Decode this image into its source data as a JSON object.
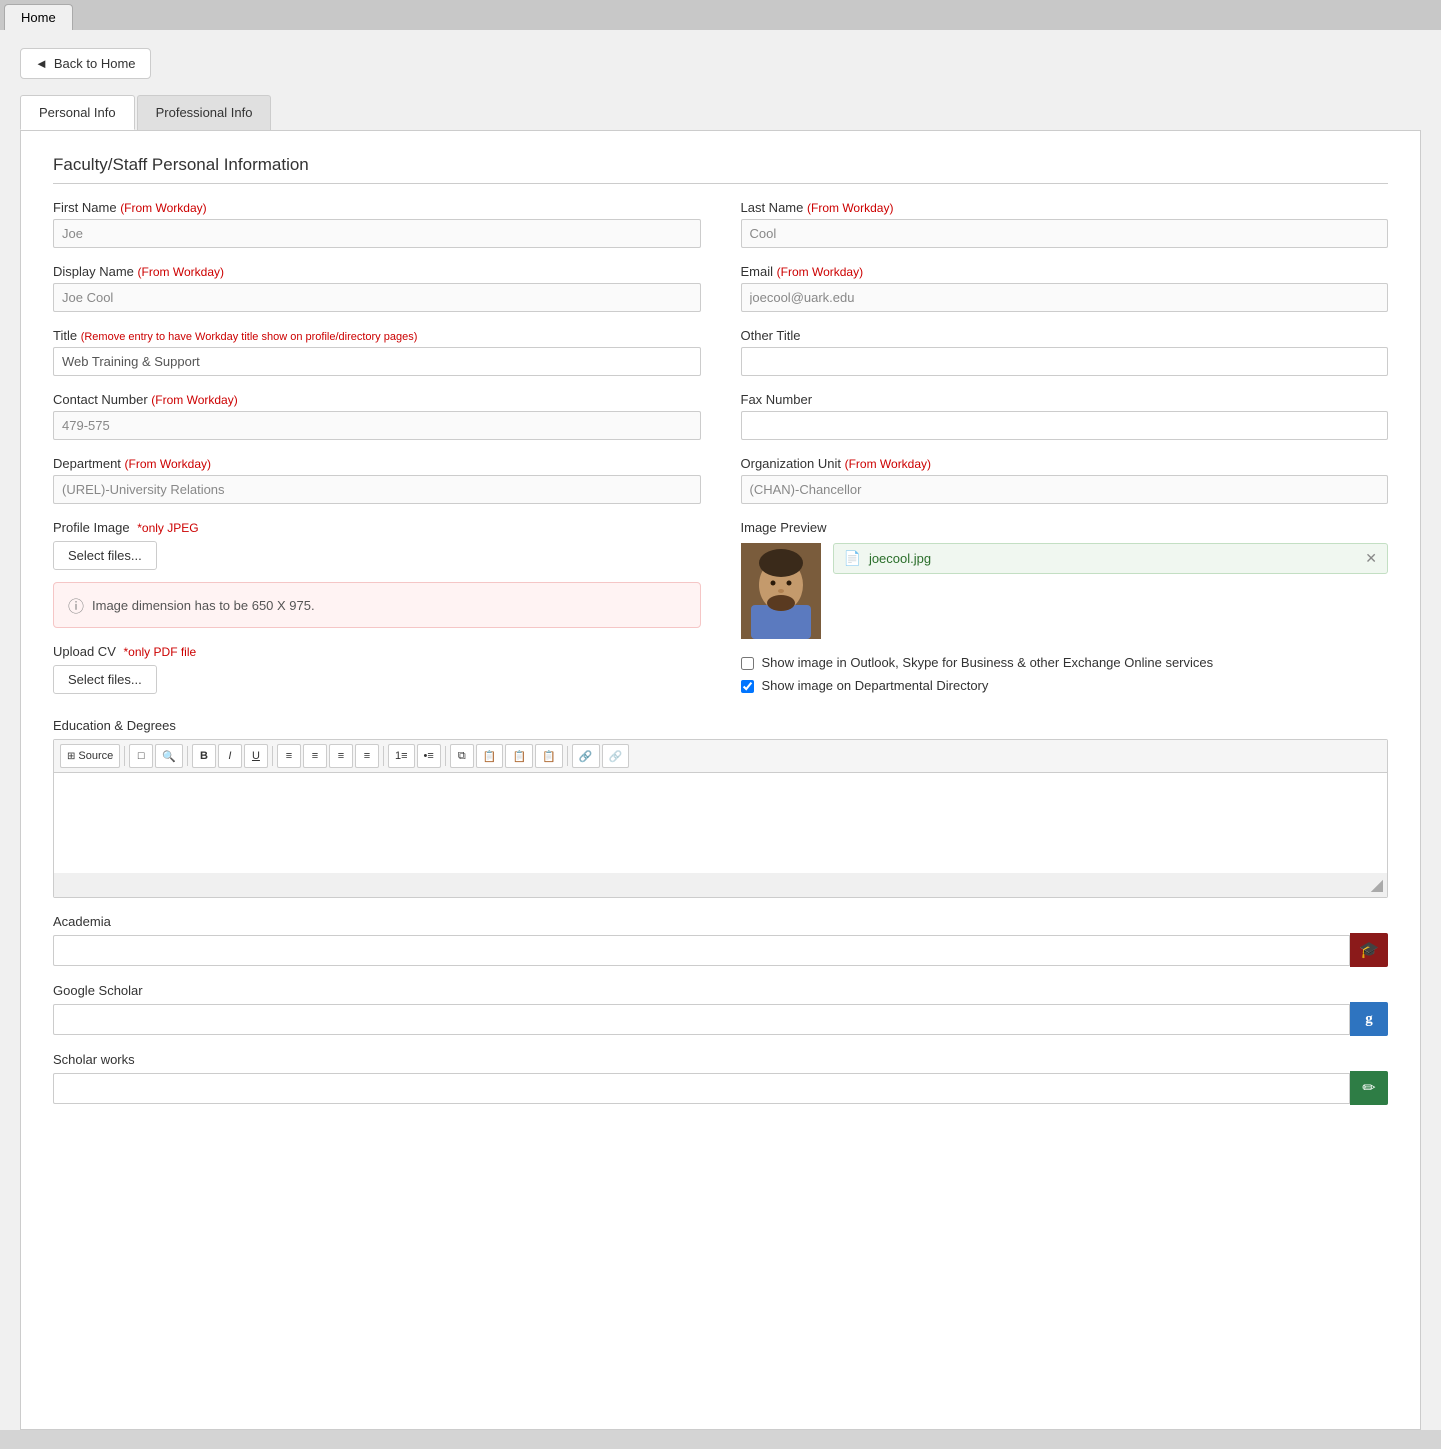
{
  "browser": {
    "tab_label": "Home"
  },
  "header": {
    "back_button_label": "Back to Home",
    "back_icon": "◄"
  },
  "tabs": [
    {
      "id": "personal",
      "label": "Personal Info",
      "active": true
    },
    {
      "id": "professional",
      "label": "Professional Info",
      "active": false
    }
  ],
  "form": {
    "section_title": "Faculty/Staff Personal Information",
    "first_name_label": "First Name",
    "first_name_from": "(From Workday)",
    "first_name_value": "Joe",
    "last_name_label": "Last Name",
    "last_name_from": "(From Workday)",
    "last_name_value": "Cool",
    "display_name_label": "Display Name",
    "display_name_from": "(From Workday)",
    "display_name_value": "Joe Cool",
    "email_label": "Email",
    "email_from": "(From Workday)",
    "email_value": "joecool@uark.edu",
    "title_label": "Title",
    "title_note": "(Remove entry to have Workday title show on profile/directory pages)",
    "title_value": "Web Training & Support",
    "other_title_label": "Other Title",
    "other_title_value": "",
    "contact_number_label": "Contact Number",
    "contact_number_from": "(From Workday)",
    "contact_number_value": "479-575",
    "fax_number_label": "Fax Number",
    "fax_number_value": "",
    "department_label": "Department",
    "department_from": "(From Workday)",
    "department_value": "(UREL)-University Relations",
    "org_unit_label": "Organization Unit",
    "org_unit_from": "(From Workday)",
    "org_unit_value": "(CHAN)-Chancellor",
    "profile_image_label": "Profile Image",
    "profile_image_note": "*only JPEG",
    "select_files_label": "Select files...",
    "image_warning": "Image dimension has to be 650 X 975.",
    "image_preview_label": "Image Preview",
    "file_name": "joecool.jpg",
    "upload_cv_label": "Upload CV",
    "upload_cv_note": "*only PDF file",
    "select_files_cv_label": "Select files...",
    "show_image_outlook_label": "Show image in Outlook, Skype for Business & other Exchange Online services",
    "show_image_outlook_checked": false,
    "show_image_directory_label": "Show image on Departmental Directory",
    "show_image_directory_checked": true,
    "education_label": "Education & Degrees",
    "rte_buttons": [
      {
        "id": "source",
        "label": "Source",
        "icon": "☰"
      },
      {
        "id": "new-page",
        "label": "",
        "icon": "📄"
      },
      {
        "id": "preview",
        "label": "",
        "icon": "🔍"
      },
      {
        "id": "bold",
        "label": "B",
        "icon": "B"
      },
      {
        "id": "italic",
        "label": "I",
        "icon": "I"
      },
      {
        "id": "underline",
        "label": "U",
        "icon": "U"
      },
      {
        "id": "align-left",
        "label": "",
        "icon": "≡"
      },
      {
        "id": "align-center",
        "label": "",
        "icon": "≡"
      },
      {
        "id": "align-right",
        "label": "",
        "icon": "≡"
      },
      {
        "id": "align-justify",
        "label": "",
        "icon": "≡"
      },
      {
        "id": "ol",
        "label": "",
        "icon": "1≡"
      },
      {
        "id": "ul",
        "label": "",
        "icon": "•≡"
      },
      {
        "id": "copy",
        "label": "",
        "icon": "⧉"
      },
      {
        "id": "paste",
        "label": "",
        "icon": "📋"
      },
      {
        "id": "paste-text",
        "label": "",
        "icon": "📋"
      },
      {
        "id": "paste-word",
        "label": "",
        "icon": "📋"
      },
      {
        "id": "link",
        "label": "",
        "icon": "🔗"
      },
      {
        "id": "unlink",
        "label": "",
        "icon": "🔗"
      }
    ],
    "academia_label": "Academia",
    "academia_value": "",
    "academia_icon": "🎓",
    "google_scholar_label": "Google Scholar",
    "google_scholar_value": "",
    "google_scholar_icon": "g",
    "scholar_works_label": "Scholar works",
    "scholar_works_value": "",
    "scholar_works_icon": "✏"
  }
}
